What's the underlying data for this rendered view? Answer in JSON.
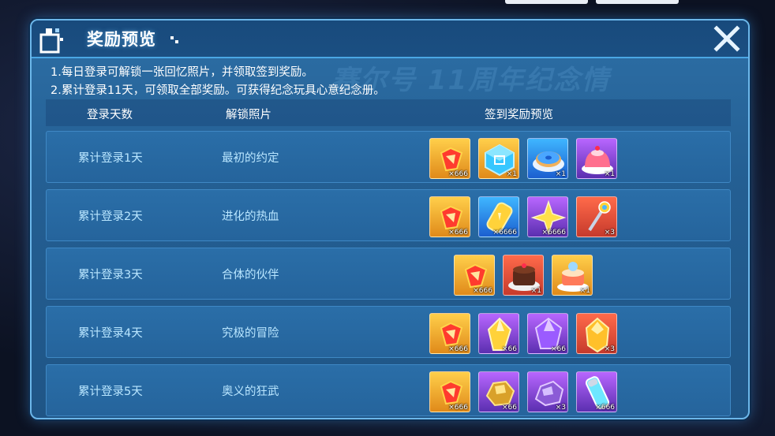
{
  "header": {
    "title": "奖励预览"
  },
  "watermark": "赛尔号 11周年纪念情",
  "rules": [
    "1.每日登录可解锁一张回忆照片，并领取签到奖励。",
    "2.累计登录11天，可领取全部奖励。可获得纪念玩具心意纪念册。"
  ],
  "table": {
    "headers": {
      "day": "登录天数",
      "photo": "解锁照片",
      "rewards": "签到奖励预览"
    },
    "rows": [
      {
        "day": "累计登录1天",
        "photo": "最初的约定",
        "rewards": [
          {
            "icon": "red-gem-icon",
            "qty": "×666",
            "bg": "gold"
          },
          {
            "icon": "blue-cube-icon",
            "qty": "×1",
            "bg": "gold"
          },
          {
            "icon": "blue-donut-icon",
            "qty": "×1",
            "bg": "blue"
          },
          {
            "icon": "pink-cake-icon",
            "qty": "×1",
            "bg": "purple"
          }
        ]
      },
      {
        "day": "累计登录2天",
        "photo": "进化的热血",
        "rewards": [
          {
            "icon": "red-gem-icon",
            "qty": "×666",
            "bg": "gold"
          },
          {
            "icon": "gold-bar-icon",
            "qty": "×6666",
            "bg": "blue"
          },
          {
            "icon": "gold-star-icon",
            "qty": "×6666",
            "bg": "purple"
          },
          {
            "icon": "magic-staff-icon",
            "qty": "×3",
            "bg": "red"
          }
        ]
      },
      {
        "day": "累计登录3天",
        "photo": "合体的伙伴",
        "rewards": [
          {
            "icon": "red-gem-icon",
            "qty": "×666",
            "bg": "gold"
          },
          {
            "icon": "chocolate-cake-icon",
            "qty": "×1",
            "bg": "red"
          },
          {
            "icon": "fruit-cake-icon",
            "qty": "×1",
            "bg": "gold"
          }
        ]
      },
      {
        "day": "累计登录4天",
        "photo": "究极的冒险",
        "rewards": [
          {
            "icon": "red-gem-icon",
            "qty": "×666",
            "bg": "gold"
          },
          {
            "icon": "gold-crystal-icon",
            "qty": "×66",
            "bg": "purple"
          },
          {
            "icon": "purple-crystal-icon",
            "qty": "×66",
            "bg": "purple"
          },
          {
            "icon": "amber-crystal-icon",
            "qty": "×3",
            "bg": "red"
          }
        ]
      },
      {
        "day": "累计登录5天",
        "photo": "奥义的狂武",
        "rewards": [
          {
            "icon": "red-gem-icon",
            "qty": "×666",
            "bg": "gold"
          },
          {
            "icon": "gold-ore-icon",
            "qty": "×66",
            "bg": "purple"
          },
          {
            "icon": "purple-ore-icon",
            "qty": "×3",
            "bg": "purple"
          },
          {
            "icon": "energy-capsule-icon",
            "qty": "×666",
            "bg": "purple"
          }
        ]
      }
    ]
  },
  "colors": {
    "panel": "#245f93",
    "border": "#6cb7ea",
    "row_text": "#b9e6ff"
  }
}
